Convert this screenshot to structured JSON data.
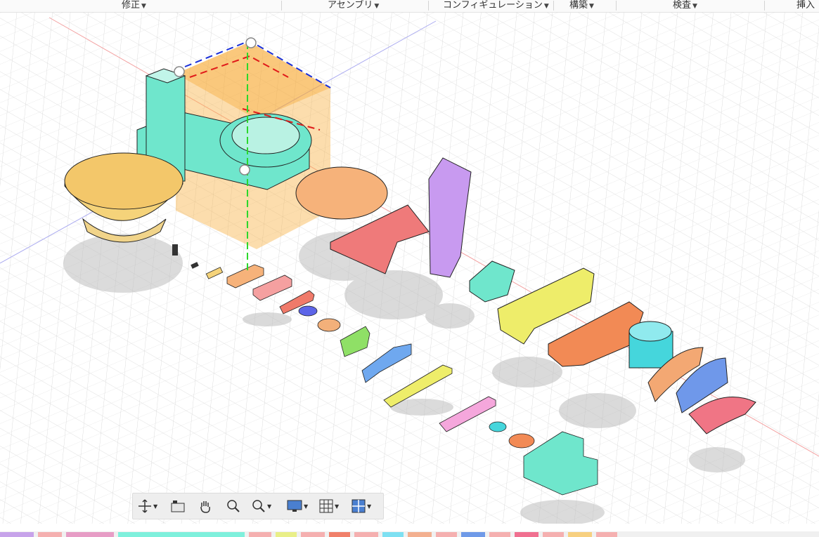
{
  "menu": {
    "modify": "修正",
    "assemble": "アセンブリ",
    "configure": "コンフィギュレーション",
    "construct": "構築",
    "inspect": "検査",
    "insert": "挿入"
  },
  "navbar": {
    "icons": [
      "orbit-icon",
      "look-at-icon",
      "pan-icon",
      "zoom-icon",
      "fit-icon",
      "display-settings-icon",
      "grid-settings-icon",
      "viewports-icon"
    ]
  },
  "timeline_colors": [
    "#c7a3ea",
    "#f5b0b0",
    "#e79dc6",
    "#7ff0dc",
    "#f5b0b0",
    "#e9ef88",
    "#f5b0b0",
    "#f0806a",
    "#f5b0b0",
    "#7ee0f2",
    "#f3b090",
    "#f5b0b0",
    "#6f9ae8",
    "#f5b0b0",
    "#f07090",
    "#f5b0b0",
    "#f7d080",
    "#f5b0b0"
  ]
}
